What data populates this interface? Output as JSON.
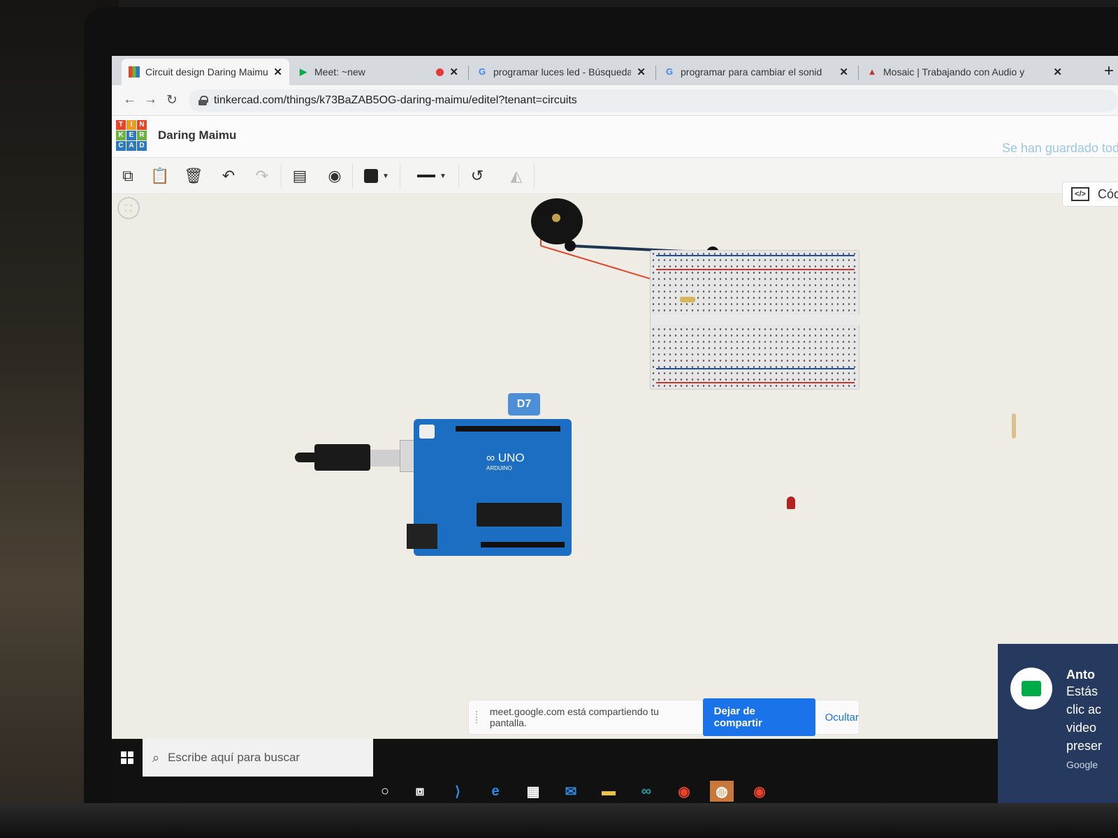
{
  "browser": {
    "tabs": [
      {
        "title": "Circuit design Daring Maimu | Tir",
        "icon": "tinkercad-favicon",
        "active": true
      },
      {
        "title": "Meet: ~new",
        "icon": "meet-favicon",
        "recording": true
      },
      {
        "title": "programar luces led - Búsqueda",
        "icon": "google-favicon"
      },
      {
        "title": "programar para cambiar el sonid",
        "icon": "google-favicon"
      },
      {
        "title": "Mosaic | Trabajando con Audio y",
        "icon": "mosaic-favicon"
      }
    ],
    "url": "tinkercad.com/things/k73BaZAB5OG-daring-maimu/editel?tenant=circuits",
    "new_tab": "+"
  },
  "app": {
    "logo_letters": [
      "T",
      "I",
      "N",
      "K",
      "E",
      "R",
      "C",
      "A",
      "D"
    ],
    "design_name": "Daring Maimu",
    "save_status": "Se han guardado todos lo",
    "code_button": "Cód",
    "brand_colors": {
      "tinkercad_red": "#e8432b",
      "tinkercad_green": "#6bb33c",
      "tinkercad_blue": "#2c79bf",
      "tinkercad_orange": "#f09a1c"
    }
  },
  "toolbar": {
    "copy_icon": "copy-icon",
    "paste_icon": "paste-icon",
    "delete_icon": "trash-icon",
    "undo_icon": "undo-icon",
    "redo_icon": "redo-icon",
    "notes_icon": "notes-icon",
    "visibility_icon": "annotation-visibility-icon",
    "color_icon": "color-swatch-icon",
    "line_icon": "wire-style-icon",
    "rotate_icon": "rotate-icon",
    "mirror_icon": "mirror-icon"
  },
  "canvas": {
    "pin_tooltip": "D7",
    "arduino_label": "UNO",
    "arduino_brand": "ARDUINO",
    "wire_colors": {
      "red": "#e0462a",
      "dark_blue": "#1c3550"
    }
  },
  "taskbar": {
    "search_placeholder": "Escribe aquí para buscar",
    "apps": [
      "cortana-icon",
      "task-view-icon",
      "vscode-icon",
      "edge-icon",
      "store-icon",
      "mail-icon",
      "file-explorer-icon",
      "arduino-ide-icon",
      "chrome-icon",
      "recorder-icon",
      "chrome-icon"
    ]
  },
  "share_bar": {
    "message": "meet.google.com está compartiendo tu pantalla.",
    "stop_button": "Dejar de compartir",
    "hide_button": "Ocultar"
  },
  "meet_toast": {
    "name": "Anto",
    "lines": [
      "Estás",
      "clic ac",
      "video",
      "preser"
    ],
    "source": "Google"
  }
}
